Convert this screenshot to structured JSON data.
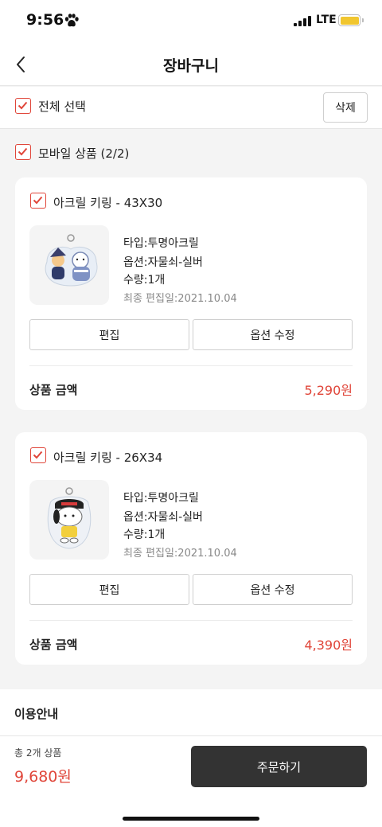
{
  "status_bar": {
    "time": "9:56",
    "network": "LTE",
    "icons": [
      "paw-icon",
      "signal-icon",
      "battery-icon"
    ]
  },
  "header": {
    "title": "장바구니",
    "back_icon": "chevron-left-icon"
  },
  "select_all": {
    "label": "전체 선택",
    "checked": true,
    "delete_label": "삭제"
  },
  "group": {
    "label": "모바일 상품 (2/2)",
    "checked": true
  },
  "items": [
    {
      "title": "아크릴 키링 - 43X30",
      "checked": true,
      "type": "타입:투명아크릴",
      "option": "옵션:자물쇠-실버",
      "quantity": "수량:1개",
      "edited": "최종 편집일:2021.10.04",
      "edit_label": "편집",
      "option_edit_label": "옵션 수정",
      "price_label": "상품 금액",
      "price": "5,290원"
    },
    {
      "title": "아크릴 키링 - 26X34",
      "checked": true,
      "type": "타입:투명아크릴",
      "option": "옵션:자물쇠-실버",
      "quantity": "수량:1개",
      "edited": "최종 편집일:2021.10.04",
      "edit_label": "편집",
      "option_edit_label": "옵션 수정",
      "price_label": "상품 금액",
      "price": "4,390원"
    }
  ],
  "info": {
    "title": "이용안내"
  },
  "footer": {
    "total_count": "총 2개 상품",
    "total_price": "9,680원",
    "order_label": "주문하기"
  },
  "colors": {
    "accent": "#e0463a",
    "order_button": "#333333",
    "background": "#f4f4f4",
    "battery": "#f1c62f"
  }
}
